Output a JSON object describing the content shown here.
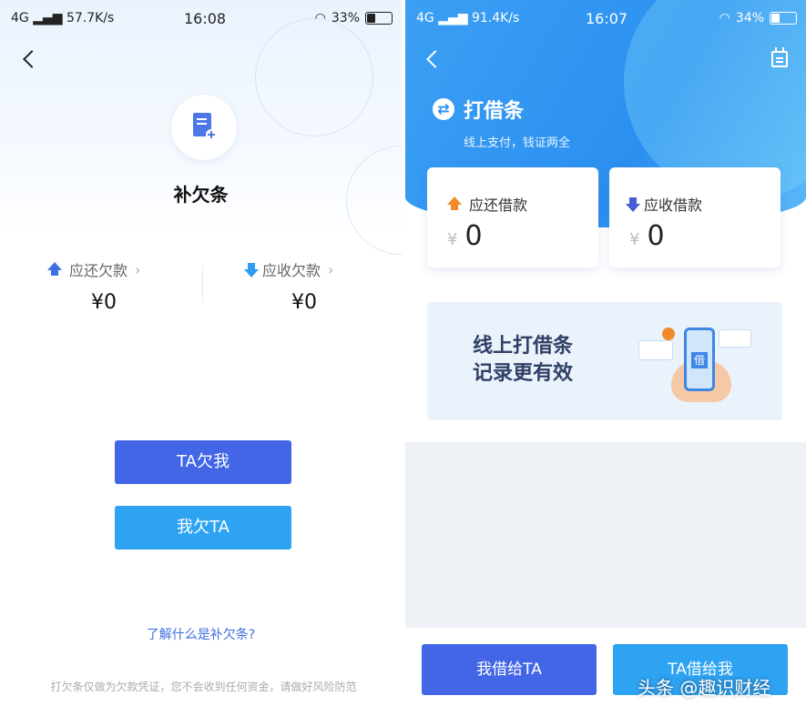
{
  "left": {
    "status": {
      "network": "4G",
      "speed": "57.7K/s",
      "time": "16:08",
      "battery": "33%"
    },
    "title": "补欠条",
    "stats": [
      {
        "label": "应还欠款",
        "value": "¥0"
      },
      {
        "label": "应收欠款",
        "value": "¥0"
      }
    ],
    "buttons": {
      "ta_owes_me": "TA欠我",
      "i_owe_ta": "我欠TA"
    },
    "learn_link": "了解什么是补欠条?",
    "disclaimer": "打欠条仅做为欠款凭证，您不会收到任何资金，请做好风险防范"
  },
  "right": {
    "status": {
      "network": "4G",
      "speed": "91.4K/s",
      "time": "16:07",
      "battery": "34%"
    },
    "brand_title": "打借条",
    "brand_subtitle": "线上支付，钱证两全",
    "cards": [
      {
        "label": "应还借款",
        "currency": "¥",
        "value": "0"
      },
      {
        "label": "应收借款",
        "currency": "¥",
        "value": "0"
      }
    ],
    "banner": {
      "line1": "线上打借条",
      "line2": "记录更有效",
      "phone_char": "借"
    },
    "buttons": {
      "lend_to_ta": "我借给TA",
      "ta_lends_me": "TA借给我"
    }
  },
  "watermark": "头条 @趣识财经",
  "colors": {
    "primary": "#4266e6",
    "secondary": "#2ea3f2",
    "header_blue": "#2b8ff0",
    "orange": "#f08a2a"
  }
}
